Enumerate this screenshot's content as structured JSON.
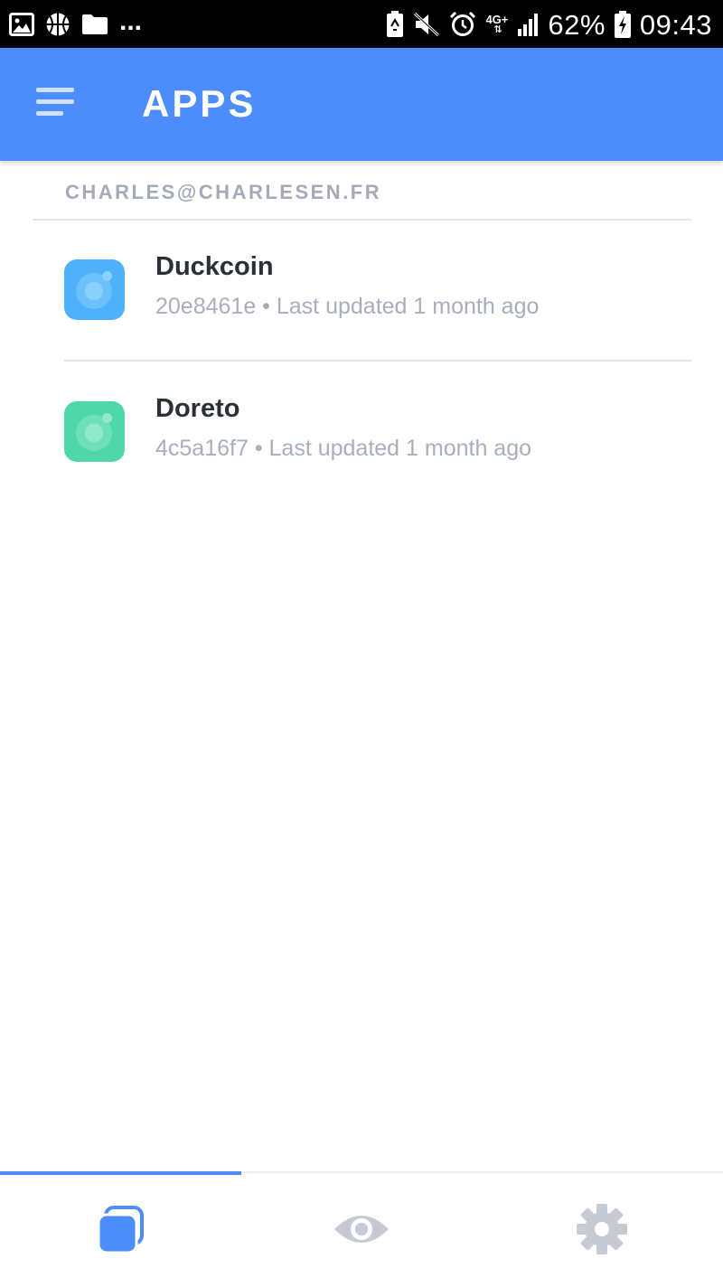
{
  "status_bar": {
    "left_icons": [
      "image-icon",
      "basketball-icon",
      "folder-icon"
    ],
    "overflow": "...",
    "right_icons": [
      "battery-saver-icon",
      "mute-icon",
      "alarm-icon"
    ],
    "network": "4G+",
    "battery": "62%",
    "time": "09:43"
  },
  "app_bar": {
    "title": "APPS",
    "menu_icon": "hamburger-menu-icon",
    "color": "#4c8dfb"
  },
  "account": {
    "email": "CHARLES@CHARLESEN.FR"
  },
  "apps": [
    {
      "name": "Duckcoin",
      "meta": "20e8461e • Last updated 1 month ago",
      "icon_color": "#4fb0fb"
    },
    {
      "name": "Doreto",
      "meta": "4c5a16f7 • Last updated 1 month ago",
      "icon_color": "#4fd6a9"
    }
  ],
  "bottom_nav": {
    "tabs": [
      {
        "icon": "apps-icon",
        "active": true
      },
      {
        "icon": "eye-icon",
        "active": false
      },
      {
        "icon": "settings-gear-icon",
        "active": false
      }
    ],
    "active_color": "#4c8dfb",
    "inactive_color": "#c5cad3"
  }
}
